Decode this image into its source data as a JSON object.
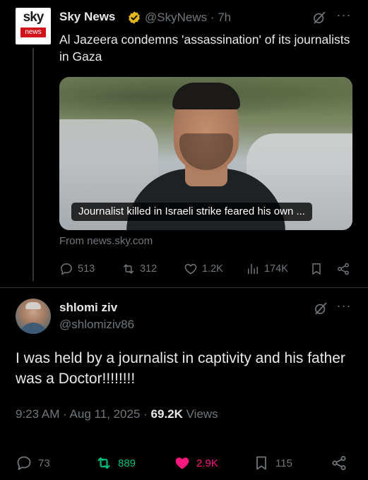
{
  "quoted": {
    "avatar_text_top": "sky",
    "avatar_text_bottom": "news",
    "name": "Sky News",
    "handle_time": "@SkyNews · 7h",
    "more": "···",
    "headline": "Al Jazeera condemns 'assassination' of its journalists in Gaza",
    "card_caption": "Journalist killed in Israeli strike feared his own ...",
    "from": "From news.sky.com",
    "actions": {
      "replies": "513",
      "reposts": "312",
      "likes": "1.2K",
      "views": "174K"
    }
  },
  "tweet": {
    "name": "shlomi ziv",
    "handle": "@shlomiziv86",
    "more": "···",
    "text": "I was held by a journalist in captivity and his father was a Doctor!!!!!!!!",
    "time": "9:23 AM · Aug 11, 2025 · ",
    "views_count": "69.2K",
    "views_label": " Views",
    "actions": {
      "replies": "73",
      "reposts": "889",
      "likes": "2.9K",
      "bookmarks": "115"
    }
  },
  "colors": {
    "background": "#000000",
    "text": "#e7e9ea",
    "muted": "#71767b",
    "verified_gold": "#e2b719",
    "repost_green": "#00ba7c",
    "like_pink": "#f91880",
    "sky_red": "#d0121b"
  }
}
